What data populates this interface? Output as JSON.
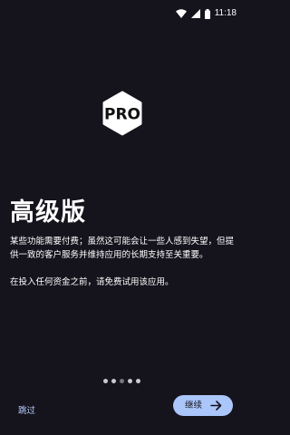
{
  "status_bar": {
    "time": "11:18",
    "icons": [
      "wifi-icon",
      "signal-icon",
      "battery-icon"
    ]
  },
  "logo": {
    "icon": "pro-badge-icon",
    "text": "PRO"
  },
  "content": {
    "title": "高级版",
    "paragraph1": "某些功能需要付费；虽然这可能会让一些人感到失望，但提供一致的客户服务并维持应用的长期支持至关重要。",
    "paragraph2": "在投入任何资金之前，请免费试用该应用。"
  },
  "pager": {
    "total": 5,
    "active_index": 2
  },
  "footer": {
    "skip_label": "跳过",
    "continue_label": "继续",
    "continue_icon": "arrow-right-icon"
  },
  "colors": {
    "background": "#15131c",
    "accent": "#aac6fb",
    "link": "#b9d0ff"
  }
}
